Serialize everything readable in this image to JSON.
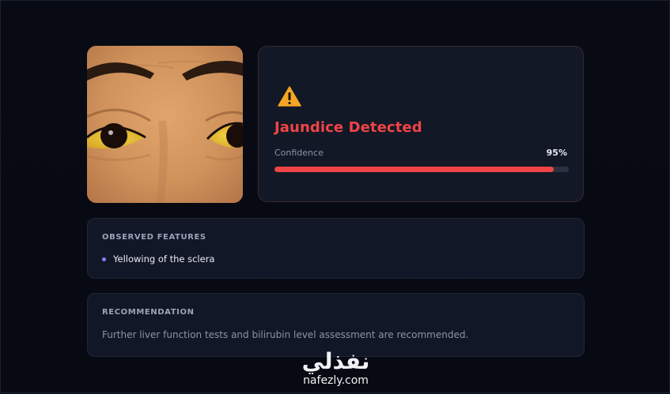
{
  "result": {
    "title": "Jaundice Detected",
    "confidence_label": "Confidence",
    "confidence_value": "95%",
    "confidence_fraction": 0.95,
    "icon": "warning-triangle-icon",
    "accent_color": "#ef4446",
    "warning_color": "#f5a623"
  },
  "features": {
    "heading": "OBSERVED FEATURES",
    "items": [
      "Yellowing of the sclera"
    ],
    "bullet_color": "#8b7cf6"
  },
  "recommendation": {
    "heading": "RECOMMENDATION",
    "text": "Further liver function tests and bilirubin level assessment are recommended."
  },
  "watermark": {
    "logo": "نفذلي",
    "url": "nafezly.com"
  }
}
